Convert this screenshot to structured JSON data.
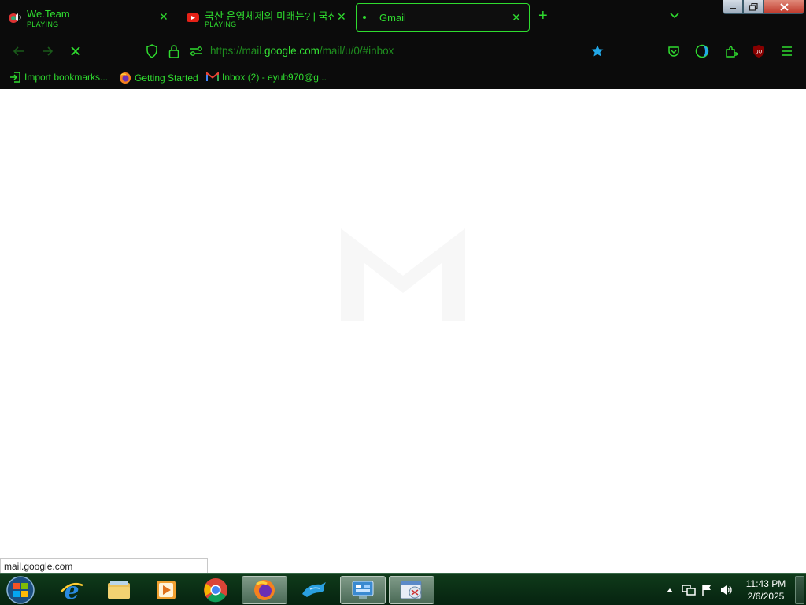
{
  "tabs": [
    {
      "title": "We.Team",
      "subtitle": "PLAYING",
      "icon": "speaker-icon"
    },
    {
      "title": "국산 운영체제의 미래는? | 국산",
      "subtitle": "PLAYING",
      "icon": "youtube-icon"
    },
    {
      "title": "Gmail",
      "icon": "loading-dot-icon",
      "active": true
    }
  ],
  "new_tab_label": "+",
  "nav": {
    "url_prefix": "https://mail.",
    "url_host": "google.com",
    "url_path": "/mail/u/0/#inbox"
  },
  "bookmarks": [
    {
      "label": "Import bookmarks...",
      "icon": "import-icon"
    },
    {
      "label": "Getting Started",
      "icon": "firefox-icon"
    },
    {
      "label": "Inbox (2) - eyub970@g...",
      "icon": "gmail-icon"
    }
  ],
  "status_url": "mail.google.com",
  "clock": {
    "time": "11:43 PM",
    "date": "2/6/2025"
  },
  "colors": {
    "accent": "#2fdc2f",
    "chrome_bg": "#0b0b0b",
    "taskbar": "#0f3a1a"
  }
}
